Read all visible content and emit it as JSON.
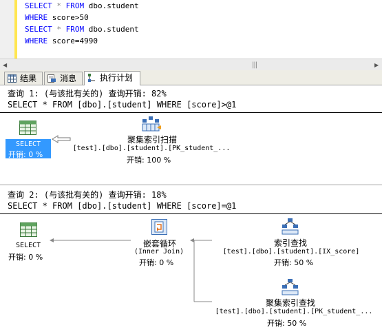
{
  "editor": {
    "lines": [
      {
        "kw1": "SELECT",
        "op": " * ",
        "kw2": "FROM",
        "rest": " dbo.student"
      },
      {
        "kw1": "WHERE",
        "op": "",
        "kw2": "",
        "rest": " score>50"
      },
      {
        "kw1": "SELECT",
        "op": " * ",
        "kw2": "FROM",
        "rest": " dbo.student"
      },
      {
        "kw1": "WHERE",
        "op": "",
        "kw2": "",
        "rest": " score=4990"
      }
    ]
  },
  "tabs": [
    {
      "label": "结果",
      "icon": "grid-icon"
    },
    {
      "label": "消息",
      "icon": "message-icon"
    },
    {
      "label": "执行计划",
      "icon": "execution-plan-icon"
    }
  ],
  "query1": {
    "header": "查询 1: (与该批有关的) 查询开销: 82%",
    "sql": "SELECT * FROM [dbo].[student] WHERE [score]>@1",
    "select_node": {
      "label": "SELECT",
      "cost": "开销: 0 %"
    },
    "scan_node": {
      "label": "聚集索引扫描",
      "object": "[test].[dbo].[student].[PK_student_...",
      "cost": "开销: 100 %"
    }
  },
  "query2": {
    "header": "查询 2: (与该批有关的) 查询开销: 18%",
    "sql": "SELECT * FROM [dbo].[student] WHERE [score]=@1",
    "select_node": {
      "label": "SELECT",
      "cost": "开销: 0 %"
    },
    "loop_node": {
      "label": "嵌套循环",
      "sub": "(Inner Join)",
      "cost": "开销: 0 %"
    },
    "seek_node": {
      "label": "索引查找",
      "object": "[test].[dbo].[student].[IX_score]",
      "cost": "开销: 50 %"
    },
    "cseek_node": {
      "label": "聚集索引查找",
      "object": "[test].[dbo].[student].[PK_student_...",
      "cost": "开销: 50 %"
    }
  },
  "colors": {
    "keyword": "#0000ff",
    "selection": "#3399ff",
    "editor_margin": "#ffe650"
  }
}
